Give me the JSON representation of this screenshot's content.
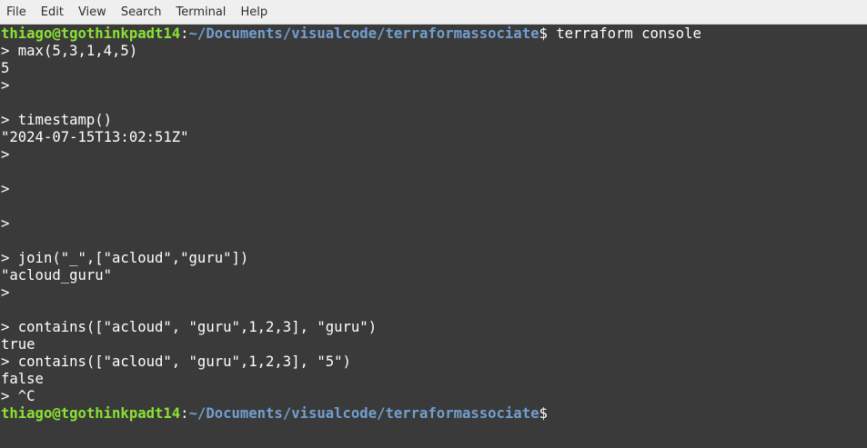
{
  "menubar": {
    "items": [
      "File",
      "Edit",
      "View",
      "Search",
      "Terminal",
      "Help"
    ]
  },
  "prompt": {
    "user_host": "thiago@tgothinkpadt14",
    "separator": ":",
    "path": "~/Documents/visualcode/terraformassociate",
    "symbol": "$"
  },
  "lines": [
    {
      "type": "prompt",
      "command": " terraform console"
    },
    {
      "type": "text",
      "text": "> max(5,3,1,4,5)"
    },
    {
      "type": "text",
      "text": "5"
    },
    {
      "type": "text",
      "text": ">"
    },
    {
      "type": "text",
      "text": ""
    },
    {
      "type": "text",
      "text": "> timestamp()"
    },
    {
      "type": "text",
      "text": "\"2024-07-15T13:02:51Z\""
    },
    {
      "type": "text",
      "text": ">"
    },
    {
      "type": "text",
      "text": ""
    },
    {
      "type": "text",
      "text": ">"
    },
    {
      "type": "text",
      "text": ""
    },
    {
      "type": "text",
      "text": ">"
    },
    {
      "type": "text",
      "text": ""
    },
    {
      "type": "text",
      "text": "> join(\"_\",[\"acloud\",\"guru\"])"
    },
    {
      "type": "text",
      "text": "\"acloud_guru\""
    },
    {
      "type": "text",
      "text": ">"
    },
    {
      "type": "text",
      "text": ""
    },
    {
      "type": "text",
      "text": "> contains([\"acloud\", \"guru\",1,2,3], \"guru\")"
    },
    {
      "type": "text",
      "text": "true"
    },
    {
      "type": "text",
      "text": "> contains([\"acloud\", \"guru\",1,2,3], \"5\")"
    },
    {
      "type": "text",
      "text": "false"
    },
    {
      "type": "text",
      "text": "> ^C"
    },
    {
      "type": "prompt",
      "command": ""
    }
  ],
  "colors": {
    "background": "#3a3a3a",
    "menubar": "#efefef",
    "user_host": "#8ae234",
    "path": "#729fcf",
    "text": "#ffffff"
  }
}
